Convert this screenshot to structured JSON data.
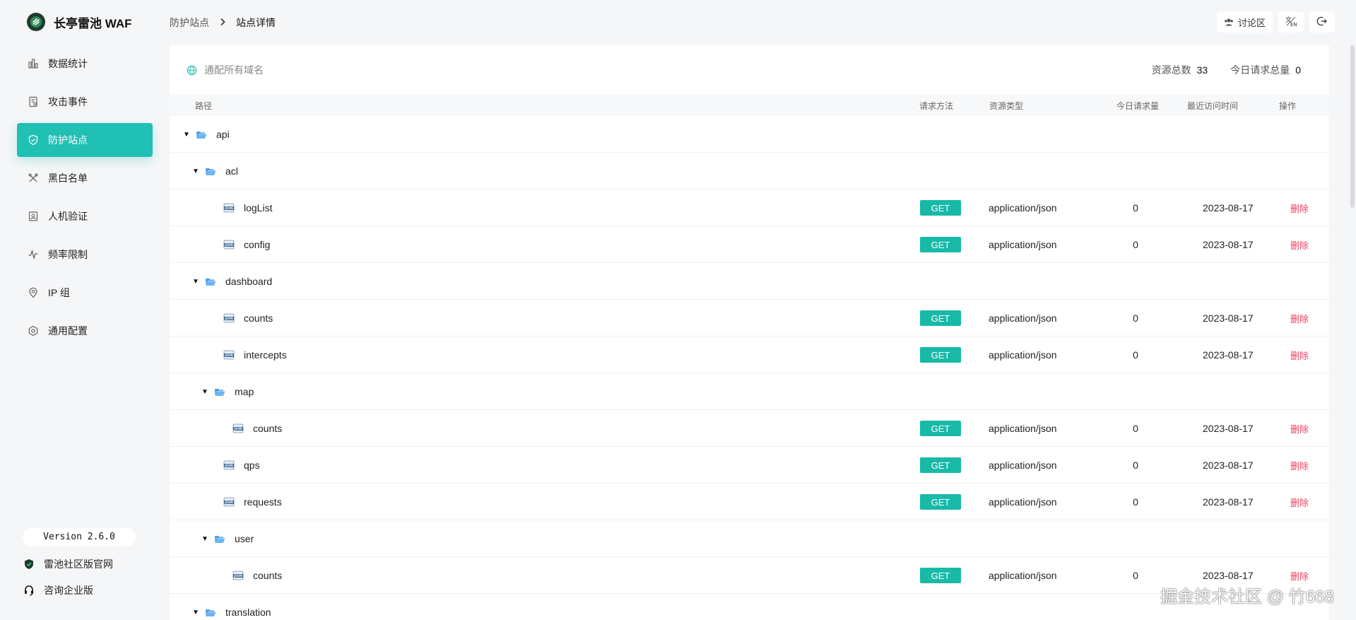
{
  "brand": {
    "title": "长亭雷池 WAF"
  },
  "sidebar": {
    "items": [
      {
        "label": "数据统计",
        "icon": "bar-chart-icon",
        "active": false
      },
      {
        "label": "攻击事件",
        "icon": "document-icon",
        "active": false
      },
      {
        "label": "防护站点",
        "icon": "shield-icon",
        "active": true
      },
      {
        "label": "黑白名单",
        "icon": "tools-icon",
        "active": false
      },
      {
        "label": "人机验证",
        "icon": "robot-icon",
        "active": false
      },
      {
        "label": "频率限制",
        "icon": "pulse-icon",
        "active": false
      },
      {
        "label": "IP 组",
        "icon": "location-icon",
        "active": false
      },
      {
        "label": "通用配置",
        "icon": "settings-icon",
        "active": false
      }
    ],
    "version": "Version 2.6.0",
    "official_site": "雷池社区版官网",
    "enterprise": "咨询企业版"
  },
  "breadcrumb": {
    "parent": "防护站点",
    "current": "站点详情"
  },
  "header": {
    "forum": "讨论区",
    "lang_icon": "translate-icon",
    "logout_icon": "logout-icon"
  },
  "card": {
    "domain": "通配所有域名",
    "total_label": "资源总数",
    "total_value": "33",
    "today_label": "今日请求总量",
    "today_value": "0"
  },
  "table": {
    "headers": {
      "path": "路径",
      "method": "请求方法",
      "type": "资源类型",
      "req": "今日请求量",
      "time": "最近访问时间",
      "op": "操作"
    },
    "rows": [
      {
        "kind": "folder",
        "level": 0,
        "name": "api"
      },
      {
        "kind": "folder",
        "level": 1,
        "name": "acl"
      },
      {
        "kind": "file",
        "level": 2,
        "name": "logList",
        "method": "GET",
        "type": "application/json",
        "req": "0",
        "time": "2023-08-17",
        "op": "删除"
      },
      {
        "kind": "file",
        "level": 2,
        "name": "config",
        "method": "GET",
        "type": "application/json",
        "req": "0",
        "time": "2023-08-17",
        "op": "删除"
      },
      {
        "kind": "folder",
        "level": 1,
        "name": "dashboard"
      },
      {
        "kind": "file",
        "level": 2,
        "name": "counts",
        "method": "GET",
        "type": "application/json",
        "req": "0",
        "time": "2023-08-17",
        "op": "删除"
      },
      {
        "kind": "file",
        "level": 2,
        "name": "intercepts",
        "method": "GET",
        "type": "application/json",
        "req": "0",
        "time": "2023-08-17",
        "op": "删除"
      },
      {
        "kind": "folder",
        "level": 2,
        "name": "map"
      },
      {
        "kind": "file",
        "level": 3,
        "name": "counts",
        "method": "GET",
        "type": "application/json",
        "req": "0",
        "time": "2023-08-17",
        "op": "删除"
      },
      {
        "kind": "file",
        "level": 2,
        "name": "qps",
        "method": "GET",
        "type": "application/json",
        "req": "0",
        "time": "2023-08-17",
        "op": "删除"
      },
      {
        "kind": "file",
        "level": 2,
        "name": "requests",
        "method": "GET",
        "type": "application/json",
        "req": "0",
        "time": "2023-08-17",
        "op": "删除"
      },
      {
        "kind": "folder",
        "level": 2,
        "name": "user"
      },
      {
        "kind": "file",
        "level": 3,
        "name": "counts",
        "method": "GET",
        "type": "application/json",
        "req": "0",
        "time": "2023-08-17",
        "op": "删除"
      },
      {
        "kind": "folder",
        "level": 1,
        "name": "translation"
      }
    ]
  },
  "watermark": "掘金技术社区 @ 竹668",
  "colors": {
    "accent": "#20c0b4",
    "method_badge": "#19b9a8",
    "delete": "#f0415f"
  }
}
